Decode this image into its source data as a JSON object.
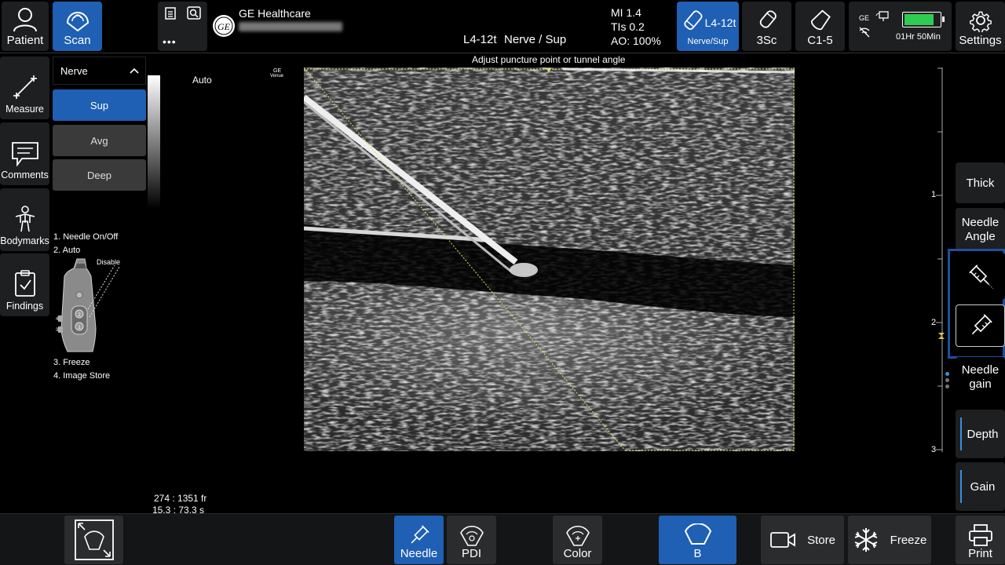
{
  "topbar": {
    "patient_label": "Patient",
    "scan_label": "Scan",
    "more_label": "•••",
    "brand": "GE Healthcare",
    "probe_preset": "L4-12t",
    "application": "Nerve / Sup",
    "mi": "MI 1.4",
    "tis": "TIs 0.2",
    "ao": "AO: 100%",
    "probes": [
      {
        "name": "L4-12t",
        "sub": "Nerve/Sup"
      },
      {
        "name": "3Sc"
      },
      {
        "name": "C1-5"
      }
    ],
    "status_ge": "GE",
    "battery_time": "01Hr  50Min",
    "battery_level": 0.85,
    "settings_label": "Settings"
  },
  "left_tools": [
    {
      "label": "Measure",
      "icon": "measure-icon"
    },
    {
      "label": "Comments",
      "icon": "comment-icon"
    },
    {
      "label": "Bodymarks",
      "icon": "bodymark-icon"
    },
    {
      "label": "Findings",
      "icon": "clipboard-check-icon"
    }
  ],
  "presets": {
    "header": "Nerve",
    "items": [
      "Sup",
      "Avg",
      "Deep"
    ],
    "active": "Sup"
  },
  "legend": {
    "items": [
      "1. Needle On/Off",
      "2. Auto",
      "3. Freeze",
      "4. Image Store"
    ],
    "disable_label": "Disable"
  },
  "image": {
    "auto_label": "Auto",
    "ge_mark": "GE",
    "venue_mark": "Venue",
    "hint": "Adjust puncture point or tunnel angle",
    "frame_counter": "274 : 1351 fr",
    "time_counter": "15.3 : 73.3 s",
    "depth_ticks": [
      "1",
      "2",
      "3"
    ]
  },
  "right_tools": {
    "thick": "Thick",
    "needle_angle": "Needle\nAngle",
    "needle_gain": "Needle\ngain",
    "depth": "Depth",
    "gain": "Gain"
  },
  "bottombar": {
    "needle": "Needle",
    "pdi": "PDI",
    "color": "Color",
    "b": "B",
    "store": "Store",
    "freeze": "Freeze",
    "print": "Print"
  },
  "colors": {
    "accent_blue": "#1f5fb4",
    "battery_green": "#2ecc52",
    "highlight_box": "#1e4fa0"
  }
}
